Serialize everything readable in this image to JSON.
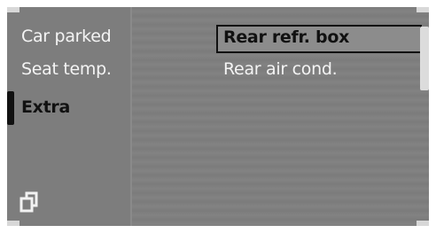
{
  "menu": {
    "left_items": [
      {
        "label": "Car parked"
      },
      {
        "label": "Seat temp."
      },
      {
        "label": "Extra"
      }
    ],
    "right_items": [
      {
        "label": "Rear refr. box"
      },
      {
        "label": "Rear air cond."
      }
    ]
  },
  "icons": {
    "back": "back-icon"
  }
}
